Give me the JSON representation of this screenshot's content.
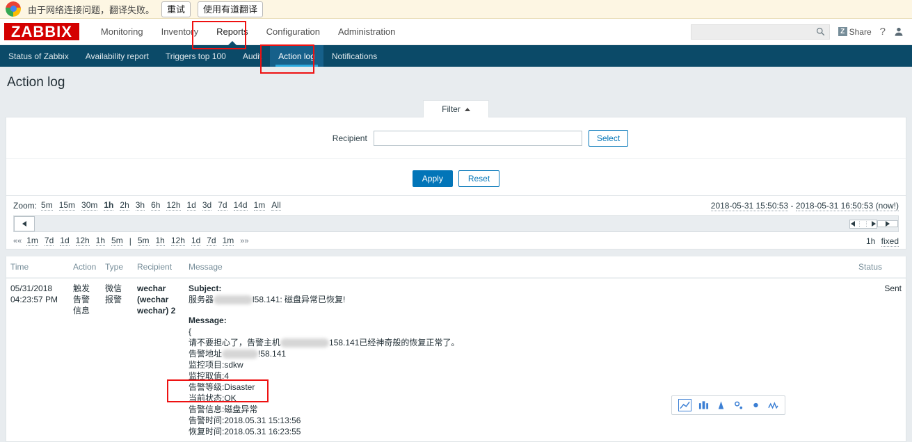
{
  "translate_bar": {
    "message": "由于网络连接问题，翻译失败。",
    "retry_label": "重试",
    "youdao_label": "使用有道翻译",
    "logo_name": "chrome-logo"
  },
  "header": {
    "logo": "ZABBIX",
    "nav": [
      {
        "label": "Monitoring",
        "active": false
      },
      {
        "label": "Inventory",
        "active": false
      },
      {
        "label": "Reports",
        "active": true
      },
      {
        "label": "Configuration",
        "active": false
      },
      {
        "label": "Administration",
        "active": false
      }
    ],
    "search_placeholder": "",
    "search_value": "",
    "share_label": "Share",
    "share_badge": "Z",
    "help_label": "?",
    "user_icon": "user-icon"
  },
  "subnav": [
    {
      "label": "Status of Zabbix",
      "active": false
    },
    {
      "label": "Availability report",
      "active": false
    },
    {
      "label": "Triggers top 100",
      "active": false
    },
    {
      "label": "Audit",
      "active": false
    },
    {
      "label": "Action log",
      "active": true
    },
    {
      "label": "Notifications",
      "active": false
    }
  ],
  "page": {
    "title": "Action log"
  },
  "filter": {
    "tab_label": "Filter",
    "recipient_label": "Recipient",
    "recipient_value": "",
    "recipient_placeholder": "",
    "select_label": "Select",
    "apply_label": "Apply",
    "reset_label": "Reset"
  },
  "time_selector": {
    "zoom_label": "Zoom:",
    "zoom_options": [
      "5m",
      "15m",
      "30m",
      "1h",
      "2h",
      "3h",
      "6h",
      "12h",
      "1d",
      "3d",
      "7d",
      "14d",
      "1m",
      "All"
    ],
    "zoom_active": "1h",
    "range_from": "2018-05-31 15:50:53",
    "range_sep": " - ",
    "range_to": "2018-05-31 16:50:53 (now!)",
    "nav_prev_icon": "double-left-chevron",
    "nav_next_icon": "double-right-chevron",
    "nav_back": [
      "1m",
      "7d",
      "1d",
      "12h",
      "1h",
      "5m"
    ],
    "nav_divider": "|",
    "nav_forward": [
      "5m",
      "1h",
      "12h",
      "1d",
      "7d",
      "1m"
    ],
    "nav_prev_label": "««",
    "nav_next_label": "»»",
    "period_label": "1h",
    "fixed_label": "fixed"
  },
  "table": {
    "headers": [
      "Time",
      "Action",
      "Type",
      "Recipient",
      "Message",
      "Status"
    ],
    "rows": [
      {
        "time": "05/31/2018 04:23:57 PM",
        "action": "触发告警信息",
        "type": "微信报警",
        "recipient": "wechar (wechar wechar) 2",
        "status": "Sent",
        "message": {
          "subject_label": "Subject:",
          "subject_prefix": "服务器",
          "subject_suffix": "l58.141: 磁盘异常已恢复!",
          "message_label": "Message:",
          "brace": "{",
          "line_host_prefix": "请不要担心了，告警主机",
          "line_host_suffix": "158.141已经神奇般的恢复正常了。",
          "line_addr_prefix": "告警地址",
          "line_addr_suffix": "!58.141",
          "line_item": "监控项目:sdkw",
          "line_value": "监控取值:4",
          "line_level": "告警等级:Disaster",
          "line_state": "当前状态:OK",
          "line_info": "告警信息:磁盘异常",
          "line_alarm_time": "告警时间:2018.05.31 15:13:56",
          "line_recover_time": "恢复时间:2018.05.31 16:23:55"
        }
      }
    ]
  },
  "float_toolbar": {
    "icons": [
      "trend-line-icon",
      "bar-chart-icon",
      "peak-icon",
      "scatter-icon",
      "dot-icon",
      "zigzag-icon"
    ]
  }
}
